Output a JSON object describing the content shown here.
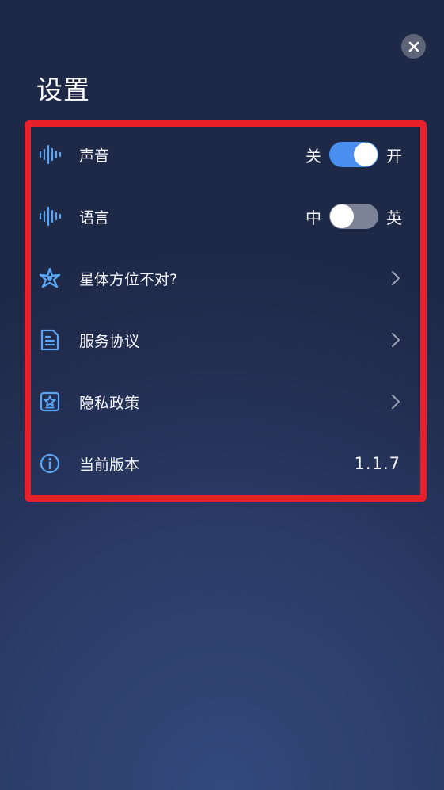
{
  "header": {
    "title": "设置",
    "close_icon": "close-icon"
  },
  "settings": {
    "sound": {
      "icon": "sound-wave-icon",
      "label": "声音",
      "off_label": "关",
      "on_label": "开",
      "enabled": true
    },
    "language": {
      "icon": "sound-wave-icon",
      "label": "语言",
      "left_label": "中",
      "right_label": "英",
      "enabled": false
    },
    "star_orientation": {
      "icon": "star-compass-icon",
      "label": "星体方位不对?"
    },
    "service_agreement": {
      "icon": "document-icon",
      "label": "服务协议"
    },
    "privacy_policy": {
      "icon": "privacy-star-icon",
      "label": "隐私政策"
    },
    "version": {
      "icon": "info-icon",
      "label": "当前版本",
      "value": "1.1.7"
    }
  },
  "colors": {
    "accent": "#4a8ef0",
    "icon_blue": "#5aa6f5",
    "highlight": "#e8202a",
    "toggle_off": "#7d8397"
  }
}
